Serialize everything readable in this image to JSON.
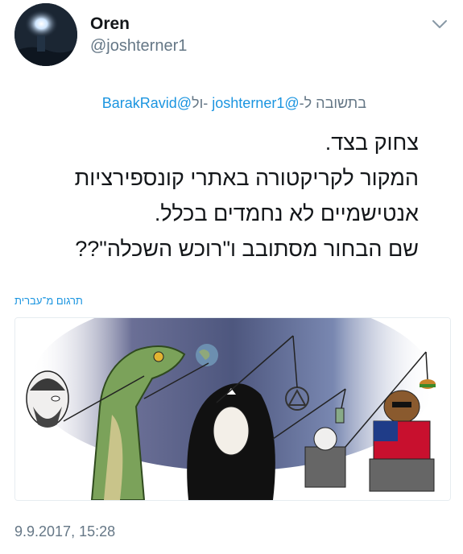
{
  "author": {
    "name": "Oren",
    "handle": "@joshterner1"
  },
  "reply": {
    "prefix": "בתשובה ל-",
    "mention1": "@joshterner1",
    "joiner": "-ול",
    "mention2": "@BarakRavid"
  },
  "tweet": {
    "lines": [
      "צחוק בצד.",
      "המקור לקריקטורה באתרי קונספירציות",
      "אנטישמיים לא נחמדים בכלל.",
      "שם הבחור מסתובב ו\"רוכש השכלה\"??"
    ]
  },
  "translate_link": "תרגום מ־עברית",
  "timestamp": "9.9.2017, 15:28",
  "icons": {
    "menu": "chevron-down-icon"
  },
  "colors": {
    "link": "#1b95e0",
    "secondary": "#657786"
  }
}
